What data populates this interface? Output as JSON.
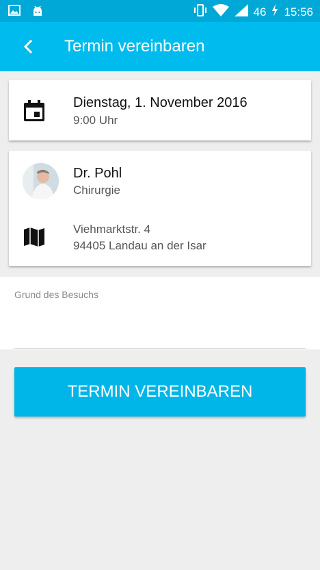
{
  "status_bar": {
    "network": "46",
    "time": "15:56",
    "icons": [
      "image-icon",
      "android-icon",
      "vibrate-icon",
      "wifi-icon",
      "signal-icon",
      "charging-icon"
    ]
  },
  "app_bar": {
    "title": "Termin vereinbaren",
    "back_icon": "chevron-left-icon"
  },
  "appointment": {
    "date": "Dienstag, 1. November 2016",
    "time": "9:00 Uhr",
    "icon": "calendar-icon"
  },
  "doctor": {
    "name": "Dr. Pohl",
    "specialty": "Chirurgie",
    "address_line1": "Viehmarktstr. 4",
    "address_line2": "94405 Landau an der Isar",
    "map_icon": "map-icon"
  },
  "reason": {
    "label": "Grund des Besuchs",
    "value": ""
  },
  "submit_button": {
    "label": "TERMIN VEREINBAREN"
  },
  "colors": {
    "status_bar": "#00a8d8",
    "app_bar": "#00bcee",
    "button": "#00b6e9",
    "background": "#eeeeee"
  }
}
